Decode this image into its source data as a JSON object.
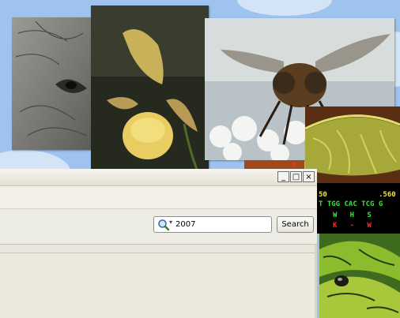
{
  "window": {
    "controls": {
      "minimize": "_",
      "maximize": "□",
      "close": "×"
    },
    "search": {
      "value": "2007",
      "button_label": "Search"
    }
  },
  "photos": [
    {
      "name": "elephant",
      "icon": "elephant-eye"
    },
    {
      "name": "orchid",
      "icon": "lady-slipper-orchid"
    },
    {
      "name": "fly",
      "icon": "fly-on-flowers"
    },
    {
      "name": "slime-mold",
      "icon": "slime-mold"
    },
    {
      "name": "viper",
      "icon": "green-viper"
    }
  ],
  "dna": {
    "ruler_left": "50",
    "ruler_right": ".560",
    "codons": "T TGG CAC TCG G",
    "aa_line1": "W   H   S",
    "aa_line2": "K   -   W",
    "marker": "B"
  },
  "colors": {
    "desktop": "#9ec3ee",
    "window_face": "#ece9d8",
    "dna_green": "#39e639",
    "dna_yellow": "#f2e43a",
    "dna_red": "#ff2b2b"
  }
}
